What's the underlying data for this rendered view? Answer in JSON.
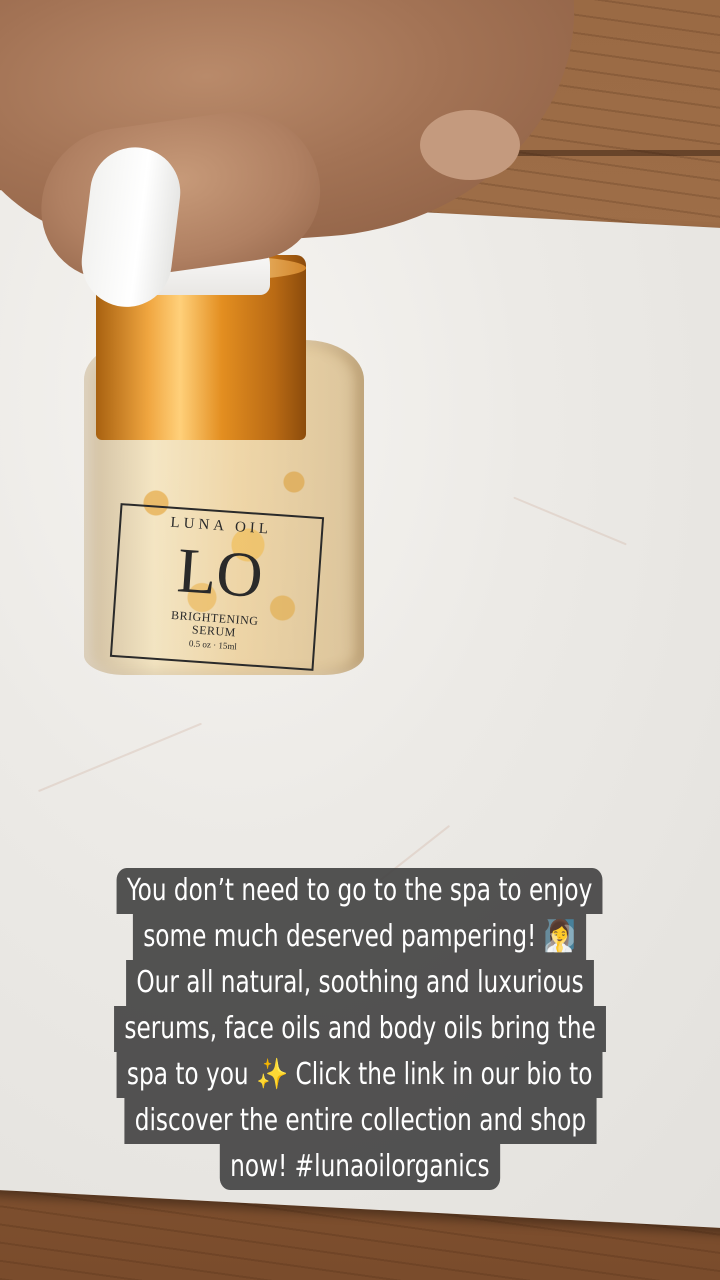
{
  "story": {
    "caption_lines": [
      "You don’t need to go to the spa to enjoy",
      "some much deserved pampering! 🧖‍♀️",
      "Our all natural, soothing and luxurious",
      "serums, face oils and body oils bring the",
      "spa to you ✨ Click the link in our bio to",
      "discover the entire collection and shop",
      "now! #lunaoilorganics"
    ]
  },
  "product_label": {
    "brand": "LUNA OIL",
    "monogram": "LO",
    "name_line1": "BRIGHTENING",
    "name_line2": "SERUM",
    "size": "0.5 oz · 15ml"
  }
}
